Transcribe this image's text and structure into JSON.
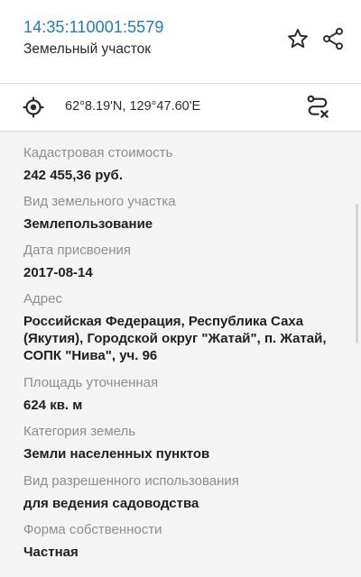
{
  "header": {
    "cadastral_number": "14:35:110001:5579",
    "parcel_type": "Земельный участок"
  },
  "coords": {
    "text": "62°8.19'N, 129°47.60'E"
  },
  "fields": [
    {
      "label": "Кадастровая стоимость",
      "value": "242 455,36 руб."
    },
    {
      "label": "Вид земельного участка",
      "value": "Землепользование"
    },
    {
      "label": "Дата присвоения",
      "value": "2017-08-14"
    },
    {
      "label": "Адрес",
      "value": "Российская Федерация, Республика Саха (Якутия), Городской округ \"Жатай\", п. Жатай, СОПК \"Нива\", уч. 96"
    },
    {
      "label": "Площадь уточненная",
      "value": "624 кв. м"
    },
    {
      "label": "Категория земель",
      "value": "Земли населенных пунктов"
    },
    {
      "label": "Вид разрешенного использования",
      "value": "для ведения садоводства"
    },
    {
      "label": "Форма собственности",
      "value": "Частная"
    }
  ],
  "icons": {
    "favorite": "star-outline-icon",
    "share": "share-icon",
    "locate": "crosshair-target-icon",
    "route": "route-clear-icon"
  },
  "colors": {
    "accent": "#1f7bb5",
    "label": "#8f8f8f",
    "value": "#1f1f1f",
    "content_background": "#f4f4f4"
  }
}
